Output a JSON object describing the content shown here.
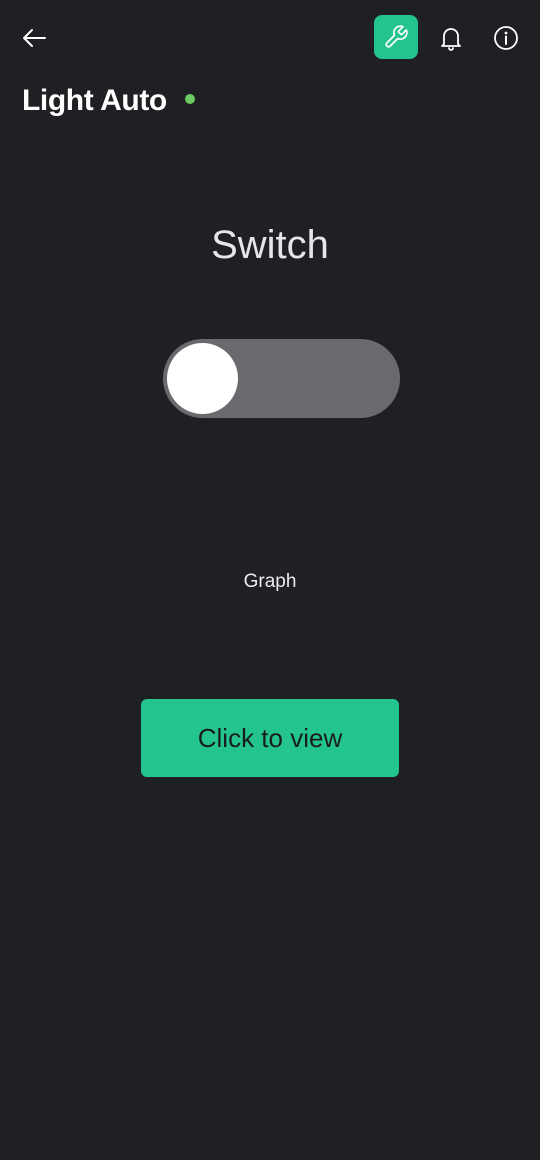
{
  "header": {
    "title": "Light Auto",
    "status": "online",
    "status_color": "#6bcb62",
    "icons": {
      "back": "arrow-left-icon",
      "settings": "wrench-icon",
      "notifications": "bell-icon",
      "info": "info-icon"
    },
    "accent_color": "#23c48e"
  },
  "widgets": {
    "switch": {
      "label": "Switch",
      "state": "off"
    },
    "graph": {
      "label": "Graph",
      "button_label": "Click to view"
    }
  }
}
